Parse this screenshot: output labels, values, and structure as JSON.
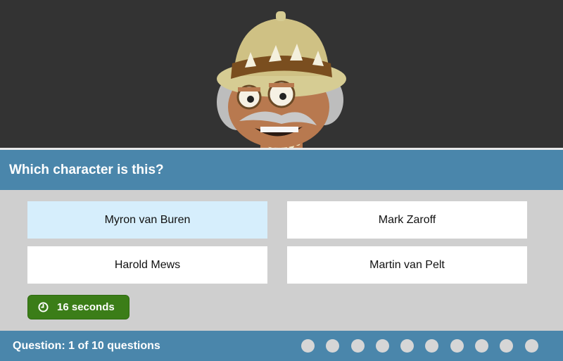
{
  "quiz": {
    "question": "Which character is this?",
    "answers": [
      {
        "label": "Myron van Buren",
        "selected": true
      },
      {
        "label": "Mark Zaroff",
        "selected": false
      },
      {
        "label": "Harold Mews",
        "selected": false
      },
      {
        "label": "Martin van Pelt",
        "selected": false
      }
    ],
    "timer_label": "16 seconds",
    "progress_label": "Question: 1 of 10 questions",
    "progress_dots": 10
  },
  "colors": {
    "stage_bg": "#333333",
    "bar_bg": "#4a86ab",
    "selected_answer": "#d6eefc",
    "timer_bg": "#3b7d18",
    "dot": "#d6d6d6"
  },
  "icons": [
    "clock-icon"
  ]
}
